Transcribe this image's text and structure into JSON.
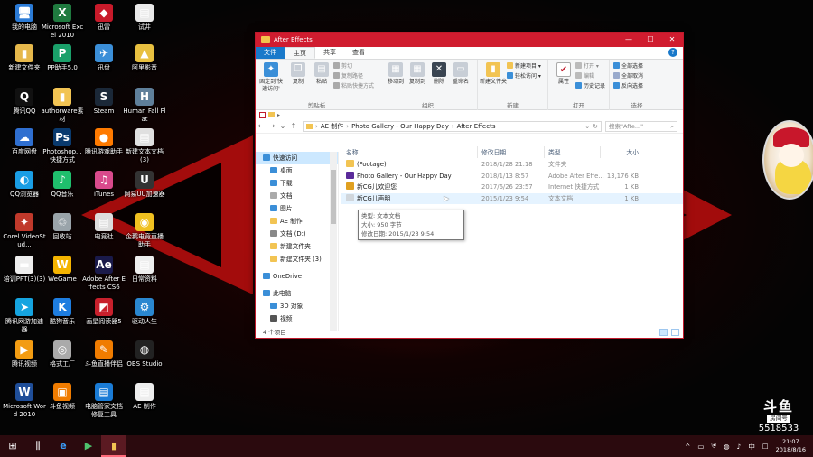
{
  "desktop": {
    "icons": [
      {
        "label": "我的电脑",
        "glyph": "🖥",
        "color": "#2b7bd6"
      },
      {
        "label": "Microsoft Excel 2010",
        "glyph": "X",
        "color": "#1f7a3f"
      },
      {
        "label": "迅雷",
        "glyph": "◆",
        "color": "#c81a2a"
      },
      {
        "label": "试井",
        "glyph": "▤",
        "color": "#e9e9e9"
      },
      {
        "label": "新建文件夹",
        "glyph": "▮",
        "color": "#e6b84b"
      },
      {
        "label": "PP助手5.0",
        "glyph": "P",
        "color": "#1aa06a"
      },
      {
        "label": "迅盘",
        "glyph": "✈",
        "color": "#3b8fd8"
      },
      {
        "label": "阿里影音",
        "glyph": "▲",
        "color": "#e8c040"
      },
      {
        "label": "腾讯QQ",
        "glyph": "Q",
        "color": "#111"
      },
      {
        "label": "authorware素材",
        "glyph": "▮",
        "color": "#f2c453"
      },
      {
        "label": "Steam",
        "glyph": "S",
        "color": "#1b2838"
      },
      {
        "label": "Human Fall Flat",
        "glyph": "H",
        "color": "#5f7f9a"
      },
      {
        "label": "百度网盘",
        "glyph": "☁",
        "color": "#2f6fd0"
      },
      {
        "label": "Photoshop... 快捷方式",
        "glyph": "Ps",
        "color": "#0a3a6e"
      },
      {
        "label": "腾讯游戏助手",
        "glyph": "●",
        "color": "#ff7a00"
      },
      {
        "label": "新建文本文档(3)",
        "glyph": "▤",
        "color": "#e0e0e0"
      },
      {
        "label": "QQ浏览器",
        "glyph": "◐",
        "color": "#1a9ee5"
      },
      {
        "label": "QQ音乐",
        "glyph": "♪",
        "color": "#1fbf6d"
      },
      {
        "label": "iTunes",
        "glyph": "♫",
        "color": "#d94a8c"
      },
      {
        "label": "网易UU加速器",
        "glyph": "U",
        "color": "#333"
      },
      {
        "label": "Corel VideoStud...",
        "glyph": "✦",
        "color": "#c0392b"
      },
      {
        "label": "回收站",
        "glyph": "♲",
        "color": "#9aa4aa"
      },
      {
        "label": "电竞社",
        "glyph": "▤",
        "color": "#ddd"
      },
      {
        "label": "企鹅电竞直播助手",
        "glyph": "◉",
        "color": "#f0c020"
      },
      {
        "label": "培训PPT(3)(3)",
        "glyph": "▬",
        "color": "#eee"
      },
      {
        "label": "WeGame",
        "glyph": "W",
        "color": "#f5b400"
      },
      {
        "label": "Adobe After Effects CS6",
        "glyph": "Ae",
        "color": "#1a1a4a"
      },
      {
        "label": "日常资料",
        "glyph": "▤",
        "color": "#eee"
      },
      {
        "label": "腾讯网游加速器",
        "glyph": "➤",
        "color": "#15a4e0"
      },
      {
        "label": "酷狗音乐",
        "glyph": "K",
        "color": "#1e7de0"
      },
      {
        "label": "画星阅读器5",
        "glyph": "◩",
        "color": "#c8202c"
      },
      {
        "label": "驱动人生",
        "glyph": "⚙",
        "color": "#2a87d0"
      },
      {
        "label": "腾讯视频",
        "glyph": "▶",
        "color": "#f39c12"
      },
      {
        "label": "格式工厂",
        "glyph": "◎",
        "color": "#aaa"
      },
      {
        "label": "斗鱼直播伴侣",
        "glyph": "✎",
        "color": "#f07c00"
      },
      {
        "label": "OBS Studio",
        "glyph": "◍",
        "color": "#222"
      },
      {
        "label": "Microsoft Word 2010",
        "glyph": "W",
        "color": "#1f4e99"
      },
      {
        "label": "斗鱼视频",
        "glyph": "▣",
        "color": "#f07c00"
      },
      {
        "label": "电脑管家文档修复工具",
        "glyph": "▤",
        "color": "#1a7cd6"
      },
      {
        "label": "AE 制作",
        "glyph": "▤",
        "color": "#eee"
      }
    ]
  },
  "window": {
    "title": "After Effects",
    "controls": {
      "minimize": "—",
      "maximize": "☐",
      "close": "✕"
    },
    "ribbon_tabs": [
      "文件",
      "主页",
      "共享",
      "查看"
    ],
    "help": "?",
    "ribbon": {
      "clipboard": {
        "label": "剪贴板",
        "pin": "固定到'快速访问'",
        "copy": "复制",
        "paste": "粘贴",
        "cut": "剪切",
        "copy_path": "复制路径",
        "paste_shortcut": "粘贴快捷方式"
      },
      "organize": {
        "label": "组织",
        "move_to": "移动到",
        "copy_to": "复制到",
        "delete": "删除",
        "rename": "重命名"
      },
      "new": {
        "label": "新建",
        "new_folder": "新建文件夹",
        "new_item": "新建项目 ▾",
        "easy_access": "轻松访问 ▾"
      },
      "open": {
        "label": "打开",
        "properties": "属性",
        "open": "打开 ▾",
        "edit": "编辑",
        "history": "历史记录"
      },
      "select": {
        "label": "选择",
        "select_all": "全部选择",
        "select_none": "全部取消",
        "invert": "反向选择"
      }
    },
    "address": {
      "crumbs": [
        "AE 制作",
        "Photo Gallery - Our Happy Day",
        "After Effects"
      ],
      "search_placeholder": "搜索\"Afte...\""
    },
    "nav_pane": [
      {
        "label": "快速访问",
        "color": "#3b8fd8",
        "selected": true,
        "pinned": false,
        "indent": 0
      },
      {
        "label": "桌面",
        "color": "#3b8fd8",
        "selected": false,
        "pinned": true,
        "indent": 1
      },
      {
        "label": "下载",
        "color": "#3b8fd8",
        "selected": false,
        "pinned": true,
        "indent": 1
      },
      {
        "label": "文档",
        "color": "#aaa",
        "selected": false,
        "pinned": true,
        "indent": 1
      },
      {
        "label": "图片",
        "color": "#3b8fd8",
        "selected": false,
        "pinned": true,
        "indent": 1
      },
      {
        "label": "AE 制作",
        "color": "#f2c453",
        "selected": false,
        "pinned": false,
        "indent": 1
      },
      {
        "label": "文档 (D:)",
        "color": "#888",
        "selected": false,
        "pinned": false,
        "indent": 1
      },
      {
        "label": "新建文件夹",
        "color": "#f2c453",
        "selected": false,
        "pinned": false,
        "indent": 1
      },
      {
        "label": "新建文件夹 (3)",
        "color": "#f2c453",
        "selected": false,
        "pinned": false,
        "indent": 1
      },
      {
        "label": "",
        "color": "",
        "selected": false,
        "pinned": false,
        "indent": 0
      },
      {
        "label": "OneDrive",
        "color": "#3b8fd8",
        "selected": false,
        "pinned": false,
        "indent": 0
      },
      {
        "label": "",
        "color": "",
        "selected": false,
        "pinned": false,
        "indent": 0
      },
      {
        "label": "此电脑",
        "color": "#3b8fd8",
        "selected": false,
        "pinned": false,
        "indent": 0
      },
      {
        "label": "3D 对象",
        "color": "#3b8fd8",
        "selected": false,
        "pinned": false,
        "indent": 1
      },
      {
        "label": "视频",
        "color": "#555",
        "selected": false,
        "pinned": false,
        "indent": 1
      }
    ],
    "columns": {
      "name": "名称",
      "date": "修改日期",
      "type": "类型",
      "size": "大小"
    },
    "files": [
      {
        "name": "(Footage)",
        "date": "2018/1/28 21:18",
        "type": "文件夹",
        "size": "",
        "icon_color": "#f2c453",
        "hover": false
      },
      {
        "name": "Photo Gallery - Our Happy Day",
        "date": "2018/1/13 8:57",
        "type": "Adobe After Effe...",
        "size": "13,176 KB",
        "icon_color": "#5a2a9a",
        "hover": false
      },
      {
        "name": "新CG儿欢迎您",
        "date": "2017/6/26 23:57",
        "type": "Internet 快捷方式",
        "size": "1 KB",
        "icon_color": "#e0a020",
        "hover": false
      },
      {
        "name": "新CG儿声明",
        "date": "2015/1/23 9:54",
        "type": "文本文档",
        "size": "1 KB",
        "icon_color": "#d0d6dc",
        "hover": true
      }
    ],
    "tooltip": {
      "type": "类型: 文本文档",
      "size": "大小: 950 字节",
      "modified": "修改日期: 2015/1/23 9:54"
    },
    "status": "4 个项目"
  },
  "overlay": {
    "logo": "斗鱼",
    "room_label": "房间号",
    "room_number": "5518533"
  },
  "taskbar": {
    "start": "⊞",
    "task_view": "⫼",
    "ie": "e",
    "media": "▶",
    "explorer": "▮",
    "tray_icons": [
      "^",
      "▭",
      "⛨",
      "◍",
      "♪",
      "中",
      "☐"
    ],
    "time": "21:07",
    "date": "2018/8/16"
  },
  "colors": {
    "titlebar": "#d01c2f",
    "accent": "#1979ca",
    "selection": "#cce8ff",
    "hover": "#e5f3ff"
  }
}
